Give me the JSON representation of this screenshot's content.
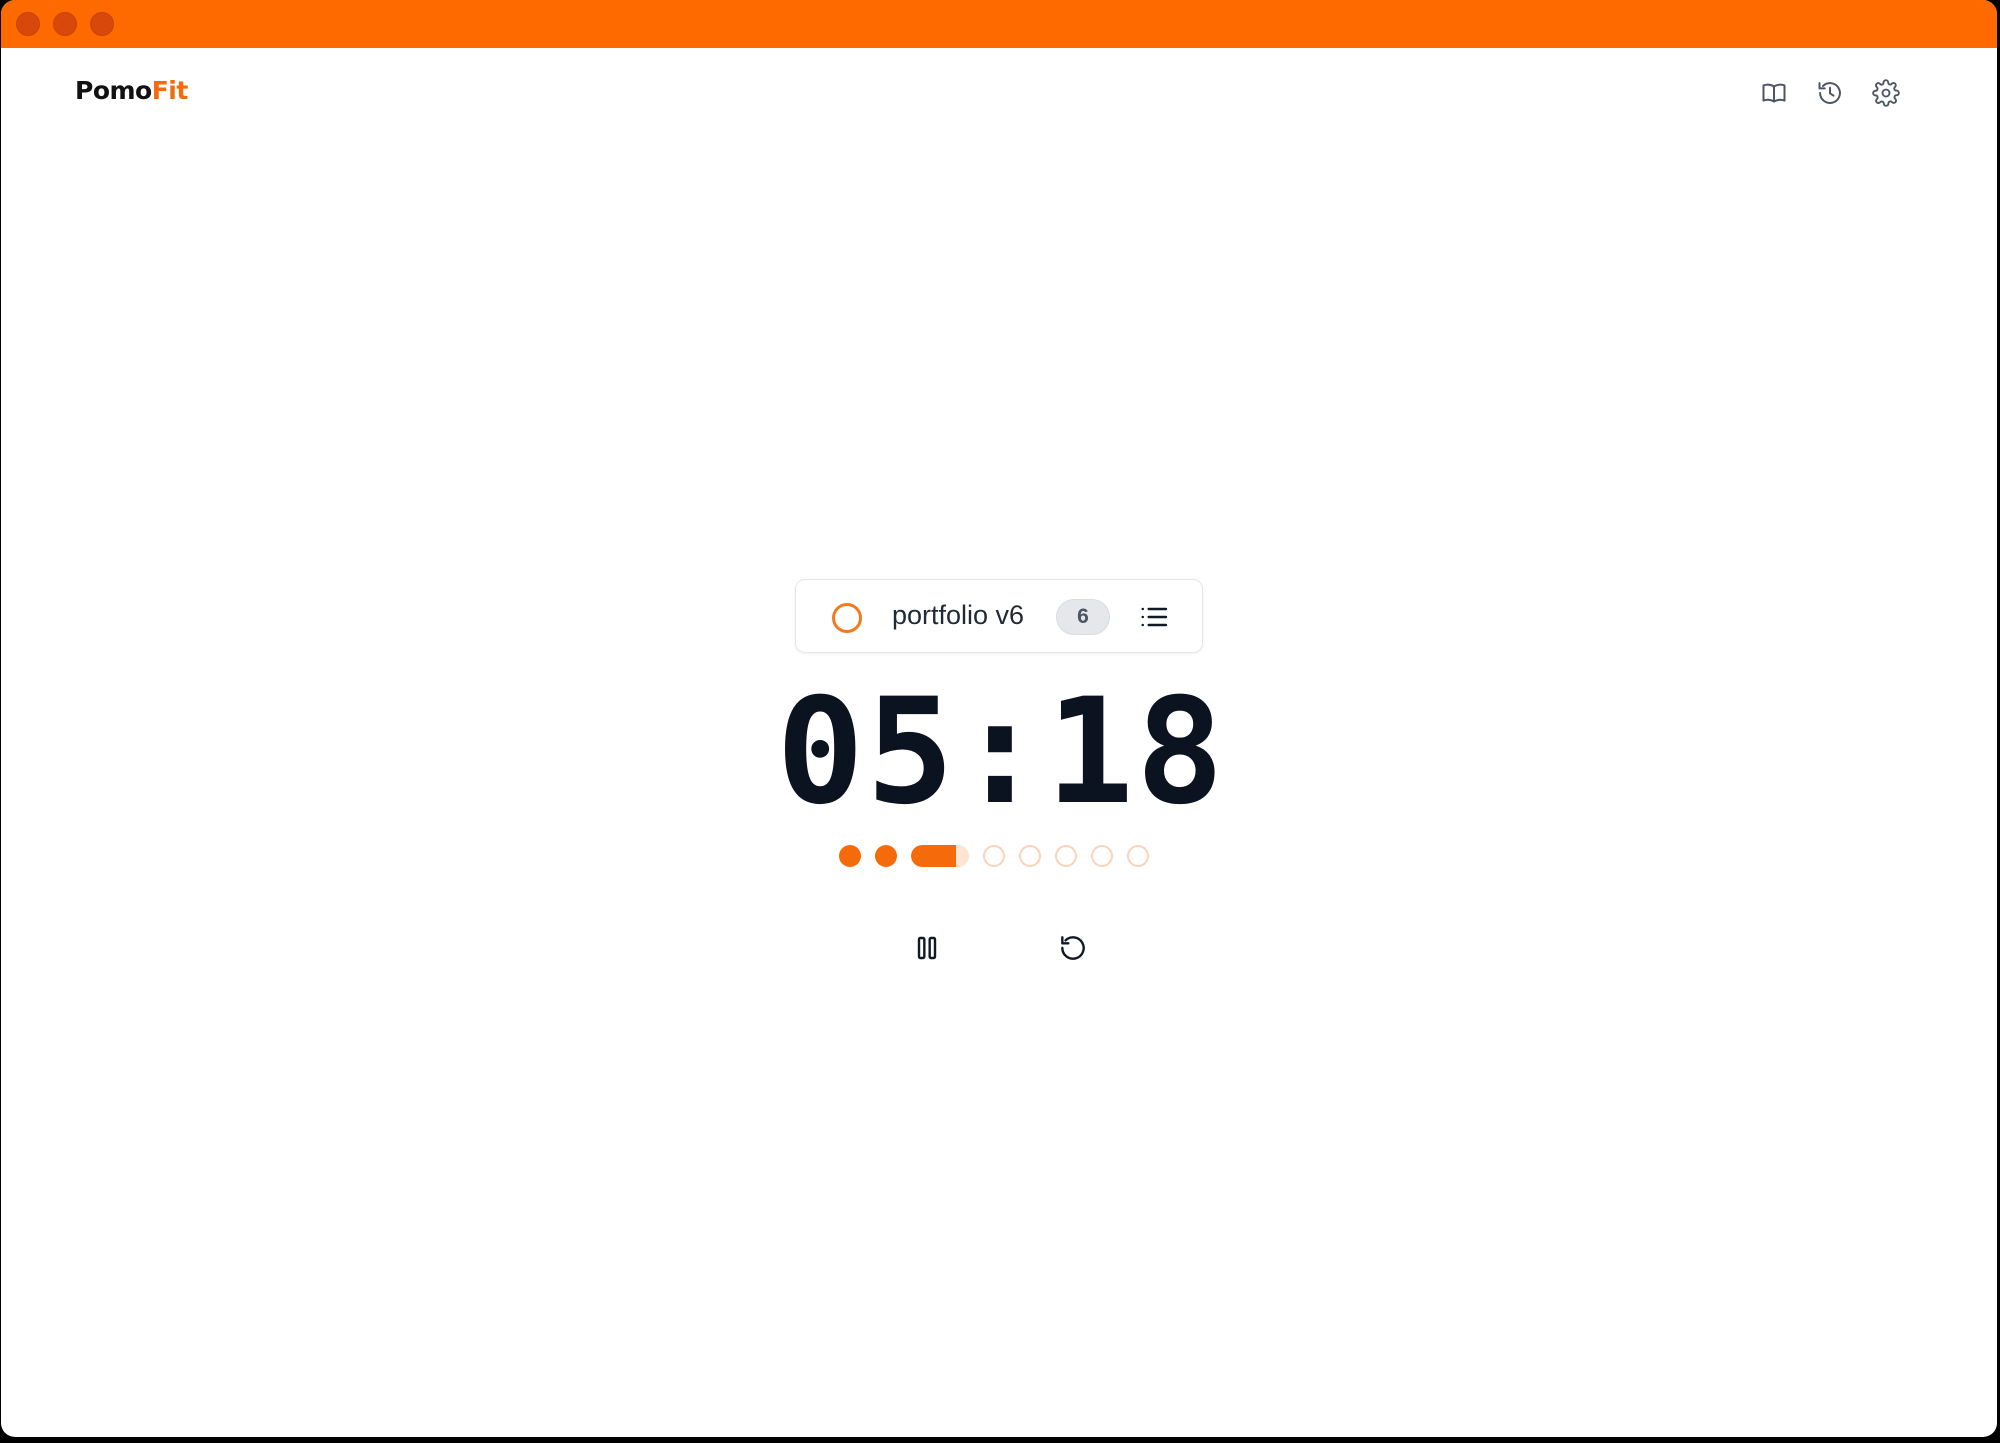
{
  "app": {
    "logo_part1": "Pomo",
    "logo_part2": "Fit",
    "accent_color": "#f56a0a",
    "titlebar_color": "#ff6a00"
  },
  "header": {
    "actions": [
      {
        "icon": "book-icon"
      },
      {
        "icon": "history-icon"
      },
      {
        "icon": "gear-icon"
      }
    ]
  },
  "task": {
    "name": "portfolio v6",
    "count": "6"
  },
  "timer": {
    "display": "05:18"
  },
  "sessions": {
    "total": 8,
    "completed": 2,
    "current_index": 3,
    "current_progress": 0.78
  },
  "controls": {
    "pause_icon": "pause-icon",
    "reset_icon": "reset-icon"
  }
}
